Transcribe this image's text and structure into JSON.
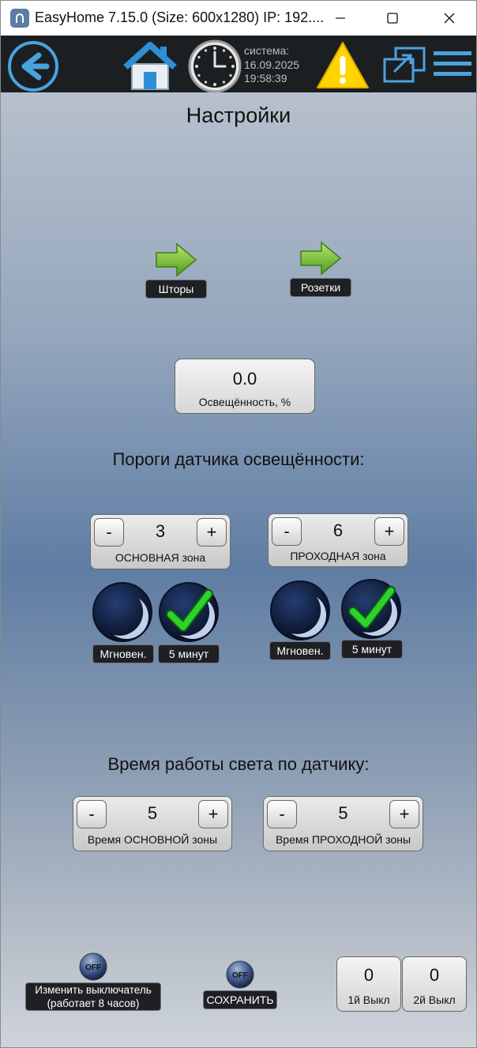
{
  "window": {
    "title": "EasyHome 7.15.0 (Size: 600x1280) IP: 192....",
    "controls": [
      "minimize-icon",
      "maximize-icon",
      "close-icon"
    ]
  },
  "header": {
    "icons": [
      "back-arrow-icon",
      "home-icon",
      "clock-icon",
      "warning-icon",
      "window-switch-icon",
      "menu-icon"
    ],
    "system_label": "система:",
    "date": "16.09.2025",
    "time": "19:58:39"
  },
  "page": {
    "title": "Настройки",
    "nav": [
      {
        "label": "Шторы",
        "icon": "green-arrow-icon"
      },
      {
        "label": "Розетки",
        "icon": "green-arrow-icon"
      }
    ],
    "illumination": {
      "value": "0.0",
      "caption": "Освещённость, %"
    },
    "thresholds_title": "Пороги датчика освещённости:",
    "thresholds": [
      {
        "value": "3",
        "caption": "ОСНОВНАЯ зона",
        "minus": "-",
        "plus": "+"
      },
      {
        "value": "6",
        "caption": "ПРОХОДНАЯ зона",
        "minus": "-",
        "plus": "+"
      }
    ],
    "modes": [
      {
        "instant": "Мгновен.",
        "delay": "5 минут",
        "selected": "delay"
      },
      {
        "instant": "Мгновен.",
        "delay": "5 минут",
        "selected": "delay"
      }
    ],
    "worktime_title": "Время работы света по датчику:",
    "worktime": [
      {
        "value": "5",
        "caption": "Время ОСНОВНОЙ зоны",
        "minus": "-",
        "plus": "+"
      },
      {
        "value": "5",
        "caption": "Время ПРОХОДНОЙ зоны",
        "minus": "-",
        "plus": "+"
      }
    ],
    "switch_change": {
      "badge": "OFF",
      "label_line1": "Изменить выключатель",
      "label_line2": "(работает 8 часов)"
    },
    "save": {
      "badge": "OFF",
      "label": "СОХРАНИТЬ"
    },
    "counters": [
      {
        "value": "0",
        "caption": "1й Выкл"
      },
      {
        "value": "0",
        "caption": "2й Выкл"
      }
    ]
  },
  "colors": {
    "accent_blue": "#4aa3df",
    "check_green": "#2ed12e",
    "arrow_green": "#7cc93a",
    "warning_yellow": "#ffd400",
    "header_bg": "#1c1f22"
  }
}
